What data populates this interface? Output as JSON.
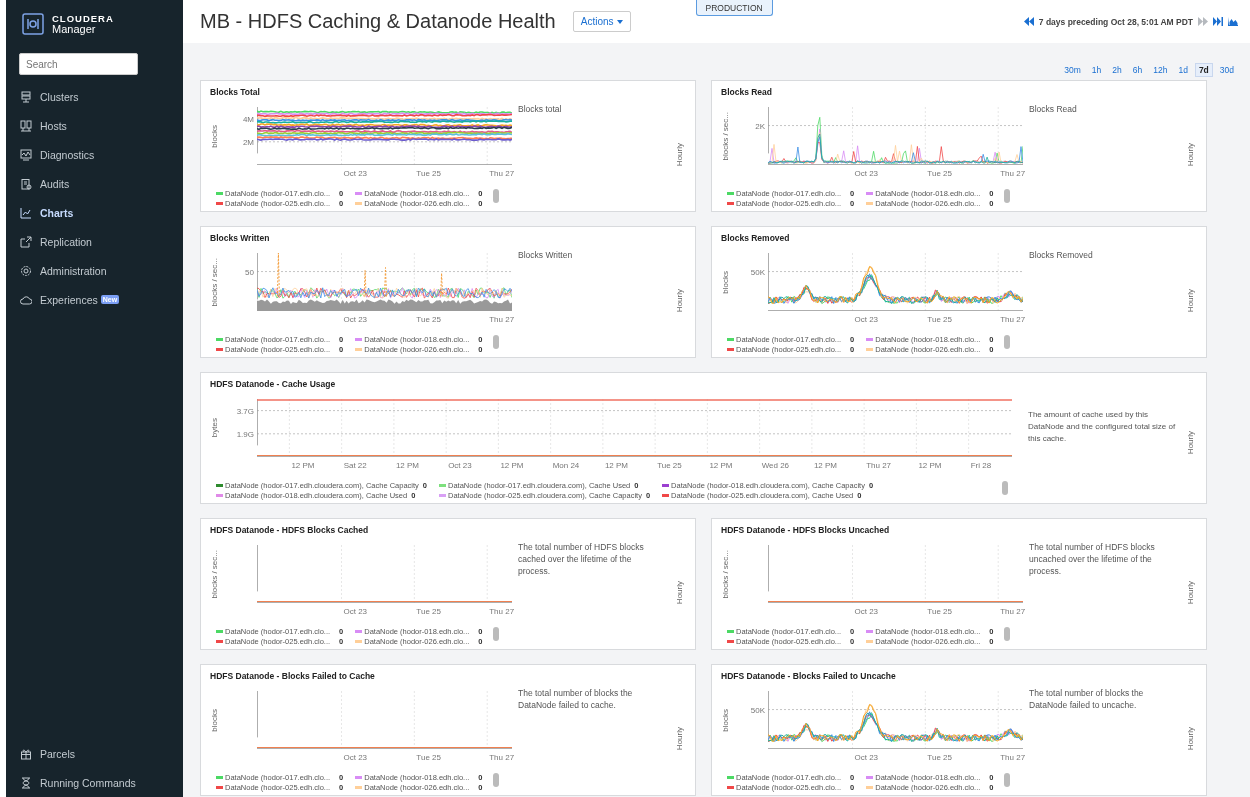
{
  "sidebar": {
    "brand": "CLOUDERA",
    "product": "Manager",
    "search": {
      "placeholder": "Search"
    },
    "items": [
      {
        "label": "Clusters",
        "selected": false
      },
      {
        "label": "Hosts",
        "selected": false
      },
      {
        "label": "Diagnostics",
        "selected": false
      },
      {
        "label": "Audits",
        "selected": false
      },
      {
        "label": "Charts",
        "selected": true
      },
      {
        "label": "Replication",
        "selected": false
      },
      {
        "label": "Administration",
        "selected": false
      },
      {
        "label": "Experiences",
        "selected": false,
        "badge": "New"
      }
    ],
    "bottom_items": [
      {
        "label": "Parcels",
        "selected": false
      },
      {
        "label": "Running Commands",
        "selected": false
      }
    ]
  },
  "header": {
    "title": "MB - HDFS Caching & Datanode Health",
    "actions": "Actions",
    "environment": "PRODUCTION",
    "time_range": "7 days preceding Oct 28, 5:01 AM PDT",
    "forward_disabled": true
  },
  "ranges": [
    {
      "label": "30m",
      "selected": false
    },
    {
      "label": "1h",
      "selected": false
    },
    {
      "label": "2h",
      "selected": false
    },
    {
      "label": "6h",
      "selected": false
    },
    {
      "label": "12h",
      "selected": false
    },
    {
      "label": "1d",
      "selected": false
    },
    {
      "label": "7d",
      "selected": true
    },
    {
      "label": "30d",
      "selected": false
    }
  ],
  "charts": [
    {
      "title": "Blocks Total",
      "ylabel": "blocks",
      "yticks": [
        "4M",
        "2M"
      ],
      "xticks": [
        "Oct 23",
        "Tue 25",
        "Thu 27"
      ],
      "plot": {
        "kind": "bands"
      },
      "description": "Blocks total",
      "period": "Hourly",
      "wide": false,
      "legend": [
        {
          "label": "DataNode (hodor-017.edh.clo...",
          "value": "0",
          "color": "#4cd964"
        },
        {
          "label": "DataNode (hodor-018.edh.clo...",
          "value": "0",
          "color": "#d88cf5"
        },
        {
          "label": "DataNode (hodor-025.edh.clo...",
          "value": "0",
          "color": "#f04848"
        },
        {
          "label": "DataNode (hodor-026.edh.clo...",
          "value": "0",
          "color": "#ffcf99"
        }
      ]
    },
    {
      "title": "Blocks Read",
      "ylabel": "blocks / sec...",
      "yticks": [
        "2K"
      ],
      "xticks": [
        "Oct 23",
        "Tue 25",
        "Thu 27"
      ],
      "plot": {
        "kind": "spikes"
      },
      "description": "Blocks Read",
      "period": "Hourly",
      "wide": false,
      "legend": [
        {
          "label": "DataNode (hodor-017.edh.clo...",
          "value": "0",
          "color": "#4cd964"
        },
        {
          "label": "DataNode (hodor-018.edh.clo...",
          "value": "0",
          "color": "#d88cf5"
        },
        {
          "label": "DataNode (hodor-025.edh.clo...",
          "value": "0",
          "color": "#f04848"
        },
        {
          "label": "DataNode (hodor-026.edh.clo...",
          "value": "0",
          "color": "#ffcf99"
        }
      ]
    },
    {
      "title": "Blocks Written",
      "ylabel": "blocks / sec...",
      "yticks": [
        "50"
      ],
      "xticks": [
        "Oct 23",
        "Tue 25",
        "Thu 27"
      ],
      "plot": {
        "kind": "noisy"
      },
      "description": "Blocks Written",
      "period": "Hourly",
      "wide": false,
      "legend": [
        {
          "label": "DataNode (hodor-017.edh.clo...",
          "value": "0",
          "color": "#4cd964"
        },
        {
          "label": "DataNode (hodor-018.edh.clo...",
          "value": "0",
          "color": "#d88cf5"
        },
        {
          "label": "DataNode (hodor-025.edh.clo...",
          "value": "0",
          "color": "#f04848"
        },
        {
          "label": "DataNode (hodor-026.edh.clo...",
          "value": "0",
          "color": "#ffcf99"
        }
      ]
    },
    {
      "title": "Blocks Removed",
      "ylabel": "blocks",
      "yticks": [
        "50K"
      ],
      "xticks": [
        "Oct 23",
        "Tue 25",
        "Thu 27"
      ],
      "plot": {
        "kind": "wave"
      },
      "description": "Blocks Removed",
      "period": "Hourly",
      "wide": false,
      "legend": [
        {
          "label": "DataNode (hodor-017.edh.clo...",
          "value": "0",
          "color": "#4cd964"
        },
        {
          "label": "DataNode (hodor-018.edh.clo...",
          "value": "0",
          "color": "#d88cf5"
        },
        {
          "label": "DataNode (hodor-025.edh.clo...",
          "value": "0",
          "color": "#f04848"
        },
        {
          "label": "DataNode (hodor-026.edh.clo...",
          "value": "0",
          "color": "#ffcf99"
        }
      ]
    },
    {
      "title": "HDFS Datanode - Cache Usage",
      "ylabel": "bytes",
      "yticks": [
        "3.7G",
        "1.9G"
      ],
      "xticks": [
        "12 PM",
        "Sat 22",
        "12 PM",
        "Oct 23",
        "12 PM",
        "Mon 24",
        "12 PM",
        "Tue 25",
        "12 PM",
        "Wed 26",
        "12 PM",
        "Thu 27",
        "12 PM",
        "Fri 28"
      ],
      "plot": {
        "kind": "capacity"
      },
      "description": "The amount of cache used by this DataNode and the configured total size of this cache.",
      "period": "Hourly",
      "wide": true,
      "legend": [
        {
          "label": "DataNode (hodor-017.edh.cloudera.com), Cache Capacity",
          "value": "0",
          "color": "#2e8b2e"
        },
        {
          "label": "DataNode (hodor-017.edh.cloudera.com), Cache Used",
          "value": "0",
          "color": "#7ee07e"
        },
        {
          "label": "DataNode (hodor-018.edh.cloudera.com), Cache Capacity",
          "value": "0",
          "color": "#9b3fd0"
        },
        {
          "label": "DataNode (hodor-018.edh.cloudera.com), Cache Used",
          "value": "0",
          "color": "#e08ae8"
        },
        {
          "label": "DataNode (hodor-025.edh.cloudera.com), Cache Capacity",
          "value": "0",
          "color": "#d9a0f5"
        },
        {
          "label": "DataNode (hodor-025.edh.cloudera.com), Cache Used",
          "value": "0",
          "color": "#f04848"
        }
      ]
    },
    {
      "title": "HDFS Datanode - HDFS Blocks Cached",
      "ylabel": "blocks / sec...",
      "xticks": [
        "Oct 23",
        "Tue 25",
        "Thu 27"
      ],
      "plot": {
        "kind": "flat"
      },
      "description": "The total number of HDFS blocks cached over the lifetime of the process.",
      "period": "Hourly",
      "wide": false,
      "legend": [
        {
          "label": "DataNode (hodor-017.edh.clo...",
          "value": "0",
          "color": "#4cd964"
        },
        {
          "label": "DataNode (hodor-018.edh.clo...",
          "value": "0",
          "color": "#d88cf5"
        },
        {
          "label": "DataNode (hodor-025.edh.clo...",
          "value": "0",
          "color": "#f04848"
        },
        {
          "label": "DataNode (hodor-026.edh.clo...",
          "value": "0",
          "color": "#ffcf99"
        }
      ]
    },
    {
      "title": "HDFS Datanode - HDFS Blocks Uncached",
      "ylabel": "blocks / sec...",
      "xticks": [
        "Oct 23",
        "Tue 25",
        "Thu 27"
      ],
      "plot": {
        "kind": "flat"
      },
      "description": "The total number of HDFS blocks uncached over the lifetime of the process.",
      "period": "Hourly",
      "wide": false,
      "legend": [
        {
          "label": "DataNode (hodor-017.edh.clo...",
          "value": "0",
          "color": "#4cd964"
        },
        {
          "label": "DataNode (hodor-018.edh.clo...",
          "value": "0",
          "color": "#d88cf5"
        },
        {
          "label": "DataNode (hodor-025.edh.clo...",
          "value": "0",
          "color": "#f04848"
        },
        {
          "label": "DataNode (hodor-026.edh.clo...",
          "value": "0",
          "color": "#ffcf99"
        }
      ]
    },
    {
      "title": "HDFS Datanode - Blocks Failed to Cache",
      "ylabel": "blocks",
      "xticks": [
        "Oct 23",
        "Tue 25",
        "Thu 27"
      ],
      "plot": {
        "kind": "flat"
      },
      "description": "The total number of blocks the DataNode failed to cache.",
      "period": "Hourly",
      "wide": false,
      "legend": [
        {
          "label": "DataNode (hodor-017.edh.clo...",
          "value": "0",
          "color": "#4cd964"
        },
        {
          "label": "DataNode (hodor-018.edh.clo...",
          "value": "0",
          "color": "#d88cf5"
        },
        {
          "label": "DataNode (hodor-025.edh.clo...",
          "value": "0",
          "color": "#f04848"
        },
        {
          "label": "DataNode (hodor-026.edh.clo...",
          "value": "0",
          "color": "#ffcf99"
        }
      ]
    },
    {
      "title": "HDFS Datanode - Blocks Failed to Uncache",
      "ylabel": "blocks",
      "yticks": [
        "50K"
      ],
      "xticks": [
        "Oct 23",
        "Tue 25",
        "Thu 27"
      ],
      "plot": {
        "kind": "wave"
      },
      "description": "The total number of blocks the DataNode failed to uncache.",
      "period": "Hourly",
      "wide": false,
      "legend": [
        {
          "label": "DataNode (hodor-017.edh.clo...",
          "value": "0",
          "color": "#4cd964"
        },
        {
          "label": "DataNode (hodor-018.edh.clo...",
          "value": "0",
          "color": "#d88cf5"
        },
        {
          "label": "DataNode (hodor-025.edh.clo...",
          "value": "0",
          "color": "#f04848"
        },
        {
          "label": "DataNode (hodor-026.edh.clo...",
          "value": "0",
          "color": "#ffcf99"
        }
      ]
    }
  ]
}
